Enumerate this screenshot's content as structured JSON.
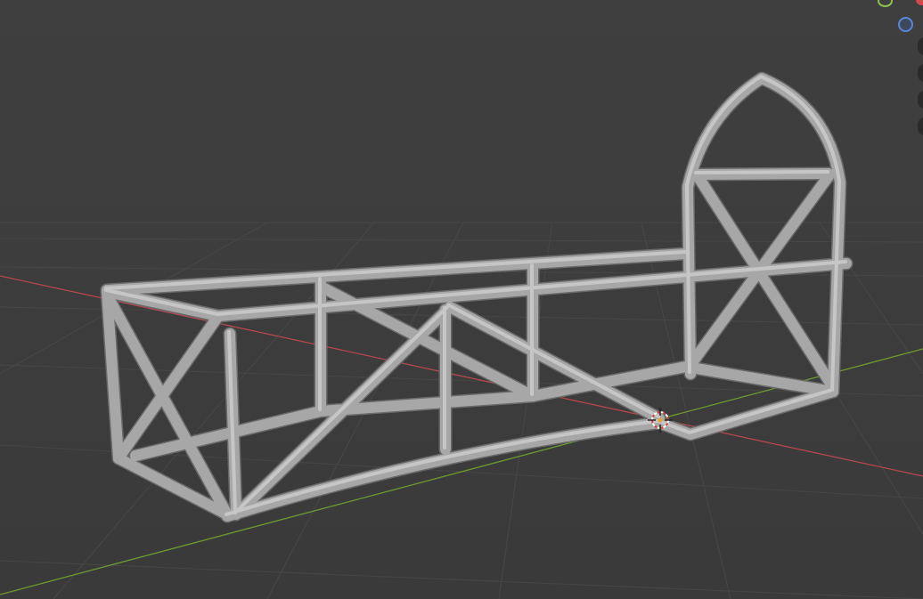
{
  "viewport": {
    "background": "#3d3d3d",
    "grid_color": "#4a4a4a",
    "x_axis_color": "#b5474e",
    "y_axis_color": "#6d9a2f",
    "mesh_color": "#a6a6a6",
    "mesh_highlight": "#c4c4c4",
    "mesh_shadow": "#6e6e6e",
    "cursor_icon": "3d-cursor-icon"
  },
  "navigation_gizmo": {
    "y_color": "#8bc34a",
    "z_color": "#5b86d6",
    "x_color": "#d04a4a"
  },
  "side_toolbar": {
    "buttons": [
      "zoom-icon",
      "hand-pan-icon",
      "camera-icon",
      "grid-view-icon"
    ]
  }
}
